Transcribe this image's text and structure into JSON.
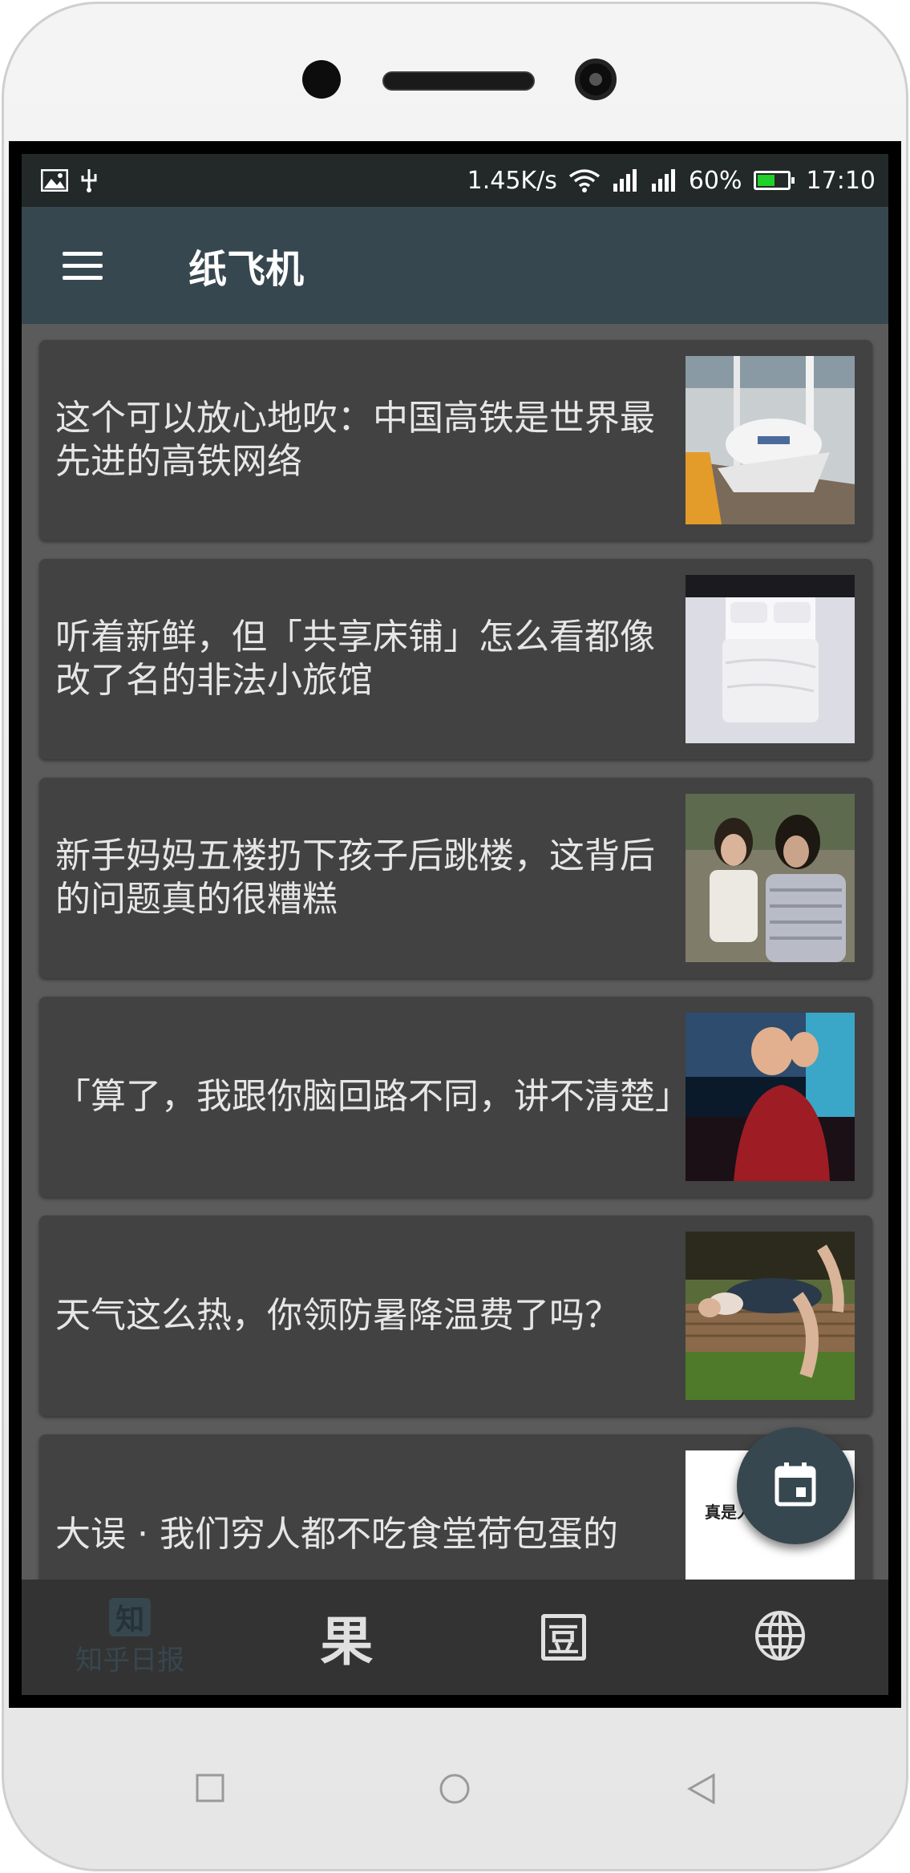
{
  "status_bar": {
    "net_speed": "1.45K/s",
    "battery_percent": "60%",
    "battery_level": 0.6,
    "time": "17:10",
    "icons": [
      "image-icon",
      "usb-icon",
      "wifi-icon",
      "signal-icon",
      "signal-icon",
      "battery-icon"
    ]
  },
  "app_bar": {
    "menu_icon": "hamburger-icon",
    "title": "纸飞机"
  },
  "articles": [
    {
      "title": "这个可以放心地吹：中国高铁是世界最先进的高铁网络",
      "thumb": "train"
    },
    {
      "title": "听着新鲜，但「共享床铺」怎么看都像改了名的非法小旅馆",
      "thumb": "bed"
    },
    {
      "title": "新手妈妈五楼扔下孩子后跳楼，这背后的问题真的很糟糕",
      "thumb": "women"
    },
    {
      "title": "「算了，我跟你脑回路不同，讲不清楚」",
      "thumb": "facepalm"
    },
    {
      "title": "天气这么热，你领防暑降温费了吗？",
      "thumb": "sleeping"
    },
    {
      "title": "大误 · 我们穷人都不吃食堂荷包蛋的",
      "thumb": "text-card",
      "thumb_text": "真是人世间的"
    }
  ],
  "fab": {
    "icon": "calendar-icon"
  },
  "bottom_nav": {
    "items": [
      {
        "icon_glyph": "知",
        "label": "知乎日报",
        "active": true
      },
      {
        "icon_glyph": "果",
        "label": "",
        "active": false
      },
      {
        "icon_glyph": "豆",
        "label": "",
        "active": false
      },
      {
        "icon": "globe-icon",
        "label": "",
        "active": false
      }
    ]
  },
  "colors": {
    "primary": "#37474f",
    "background": "#5b5b5b",
    "card": "#424242",
    "status_bar": "#232829",
    "battery": "#1fd12a"
  }
}
